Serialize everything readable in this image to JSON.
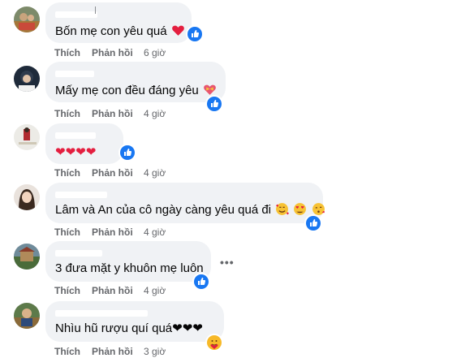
{
  "comments": [
    {
      "text": "Bốn mẹ con yêu quá",
      "emojis": [
        "heart"
      ],
      "like_label": "Thích",
      "reply_label": "Phản hồi",
      "time": "6 giờ",
      "reaction": "like"
    },
    {
      "text": "Mấy mẹ con đều đáng yêu",
      "emojis": [
        "heart-with-bow"
      ],
      "like_label": "Thích",
      "reply_label": "Phản hồi",
      "time": "4 giờ",
      "reaction": "like"
    },
    {
      "text": "❤❤❤❤",
      "emojis": [],
      "like_label": "Thích",
      "reply_label": "Phản hồi",
      "time": "4 giờ",
      "reaction": "like"
    },
    {
      "text": "Lâm và An của cô ngày càng yêu quá đi",
      "emojis": [
        "smiling-face-with-hearts",
        "heart-eyes",
        "kissing-face"
      ],
      "like_label": "Thích",
      "reply_label": "Phản hồi",
      "time": "4 giờ",
      "reaction": "like"
    },
    {
      "text": "3 đưa mặt y khuôn mẹ luôn",
      "emojis": [],
      "like_label": "Thích",
      "reply_label": "Phản hồi",
      "time": "4 giờ",
      "reaction": "like",
      "more_label": "•••"
    },
    {
      "text": "Nhìu hũ rượu quí quá❤❤❤",
      "emojis": [],
      "like_label": "Thích",
      "reply_label": "Phản hồi",
      "time": "3 giờ",
      "reaction": "care"
    }
  ],
  "colors": {
    "bubble": "#f0f2f5",
    "like_blue": "#1877f2",
    "heart_red": "#e41e3f",
    "muted": "#65676b",
    "care_yellow": "#f7b928"
  }
}
